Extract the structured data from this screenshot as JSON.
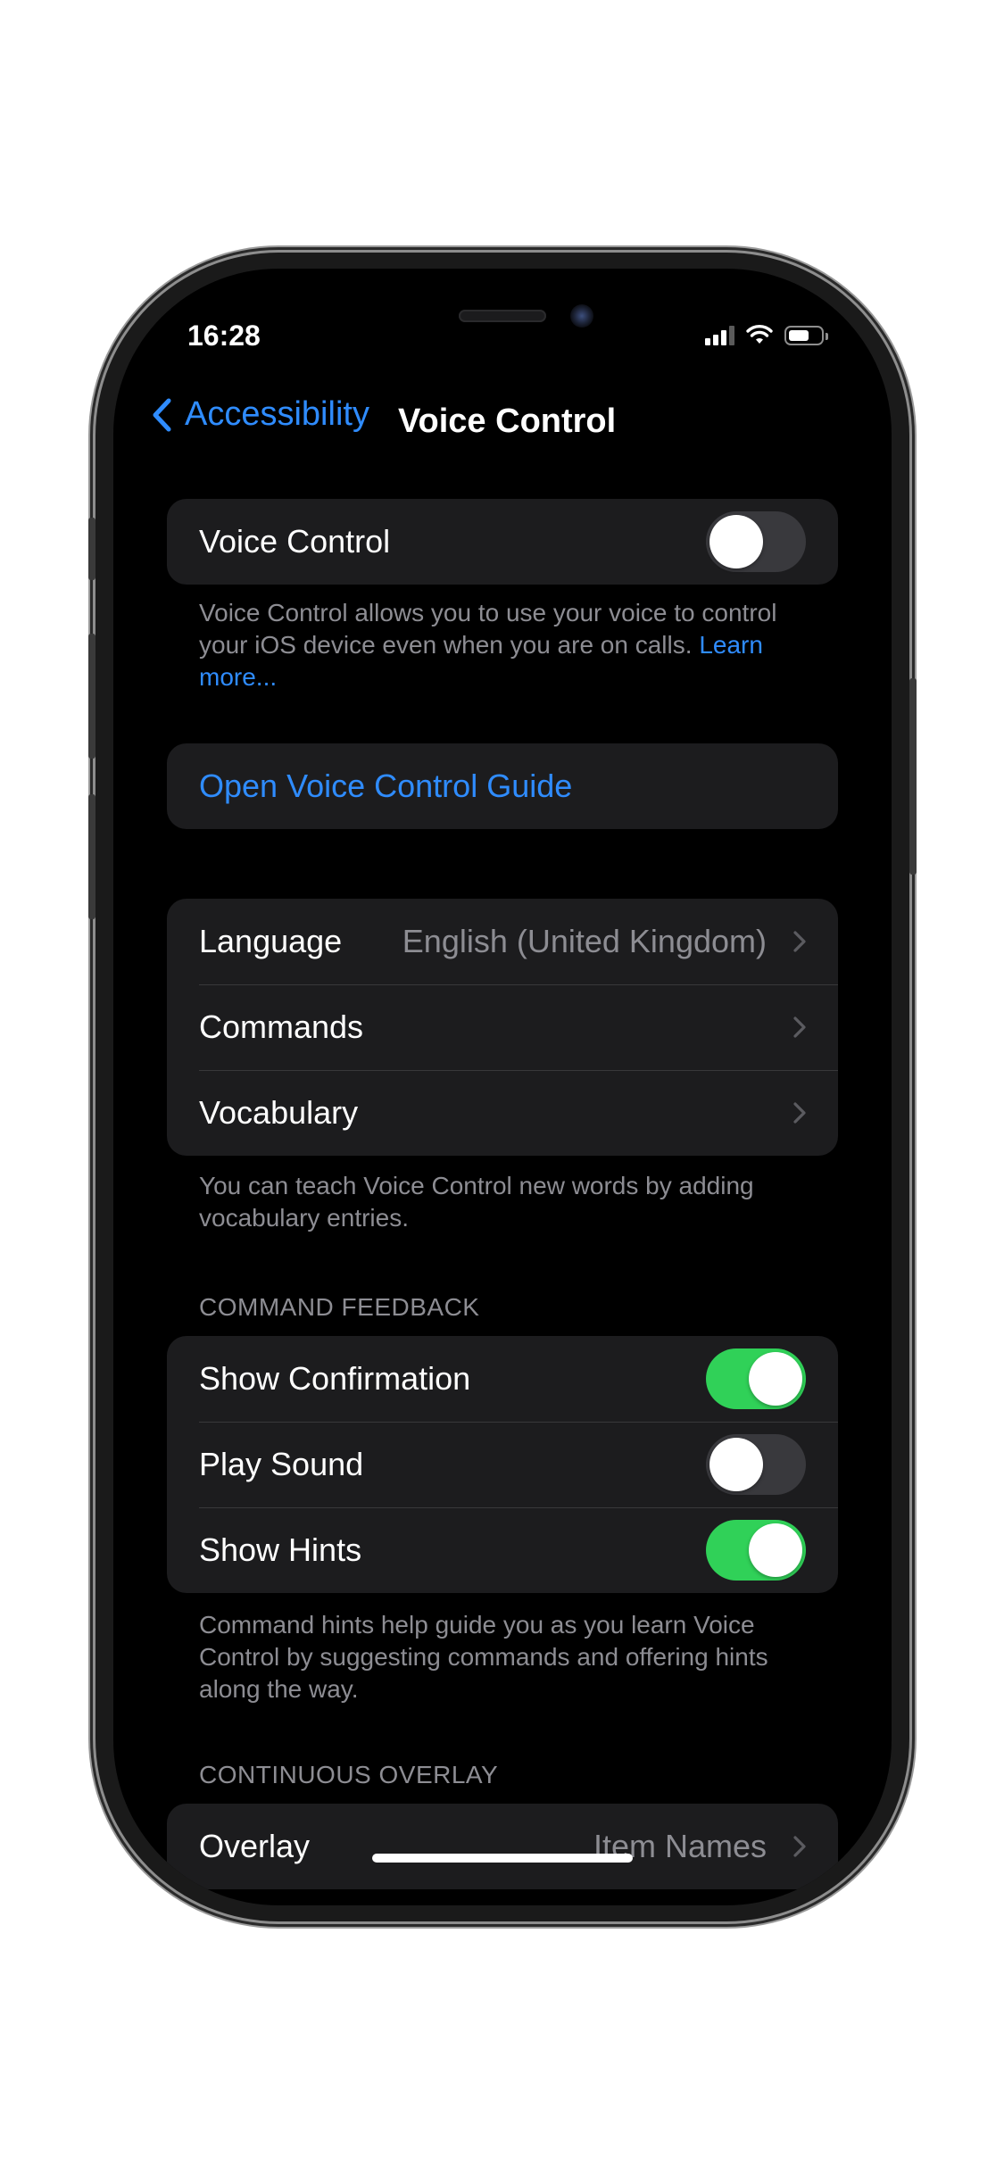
{
  "status_bar": {
    "time": "16:28"
  },
  "nav": {
    "back_label": "Accessibility",
    "title": "Voice Control"
  },
  "voice_control": {
    "label": "Voice Control",
    "enabled": false,
    "footer_text": "Voice Control allows you to use your voice to control your iOS device even when you are on calls.",
    "footer_link": "Learn more..."
  },
  "guide": {
    "label": "Open Voice Control Guide"
  },
  "settings": {
    "items": [
      {
        "label": "Language",
        "value": "English (United Kingdom)"
      },
      {
        "label": "Commands",
        "value": ""
      },
      {
        "label": "Vocabulary",
        "value": ""
      }
    ],
    "footer_text": "You can teach Voice Control new words by adding vocabulary entries."
  },
  "command_feedback": {
    "header": "COMMAND FEEDBACK",
    "items": [
      {
        "label": "Show Confirmation",
        "enabled": true
      },
      {
        "label": "Play Sound",
        "enabled": false
      },
      {
        "label": "Show Hints",
        "enabled": true
      }
    ],
    "footer_text": "Command hints help guide you as you learn Voice Control by suggesting commands and offering hints along the way."
  },
  "continuous_overlay": {
    "header": "CONTINUOUS OVERLAY",
    "items": [
      {
        "label": "Overlay",
        "value": "Item Names"
      }
    ]
  },
  "colors": {
    "accent": "#2f8cff",
    "toggle_on": "#30d158",
    "toggle_off": "#39393d",
    "group_bg": "#1c1c1e",
    "secondary_text": "#8d8d93"
  }
}
